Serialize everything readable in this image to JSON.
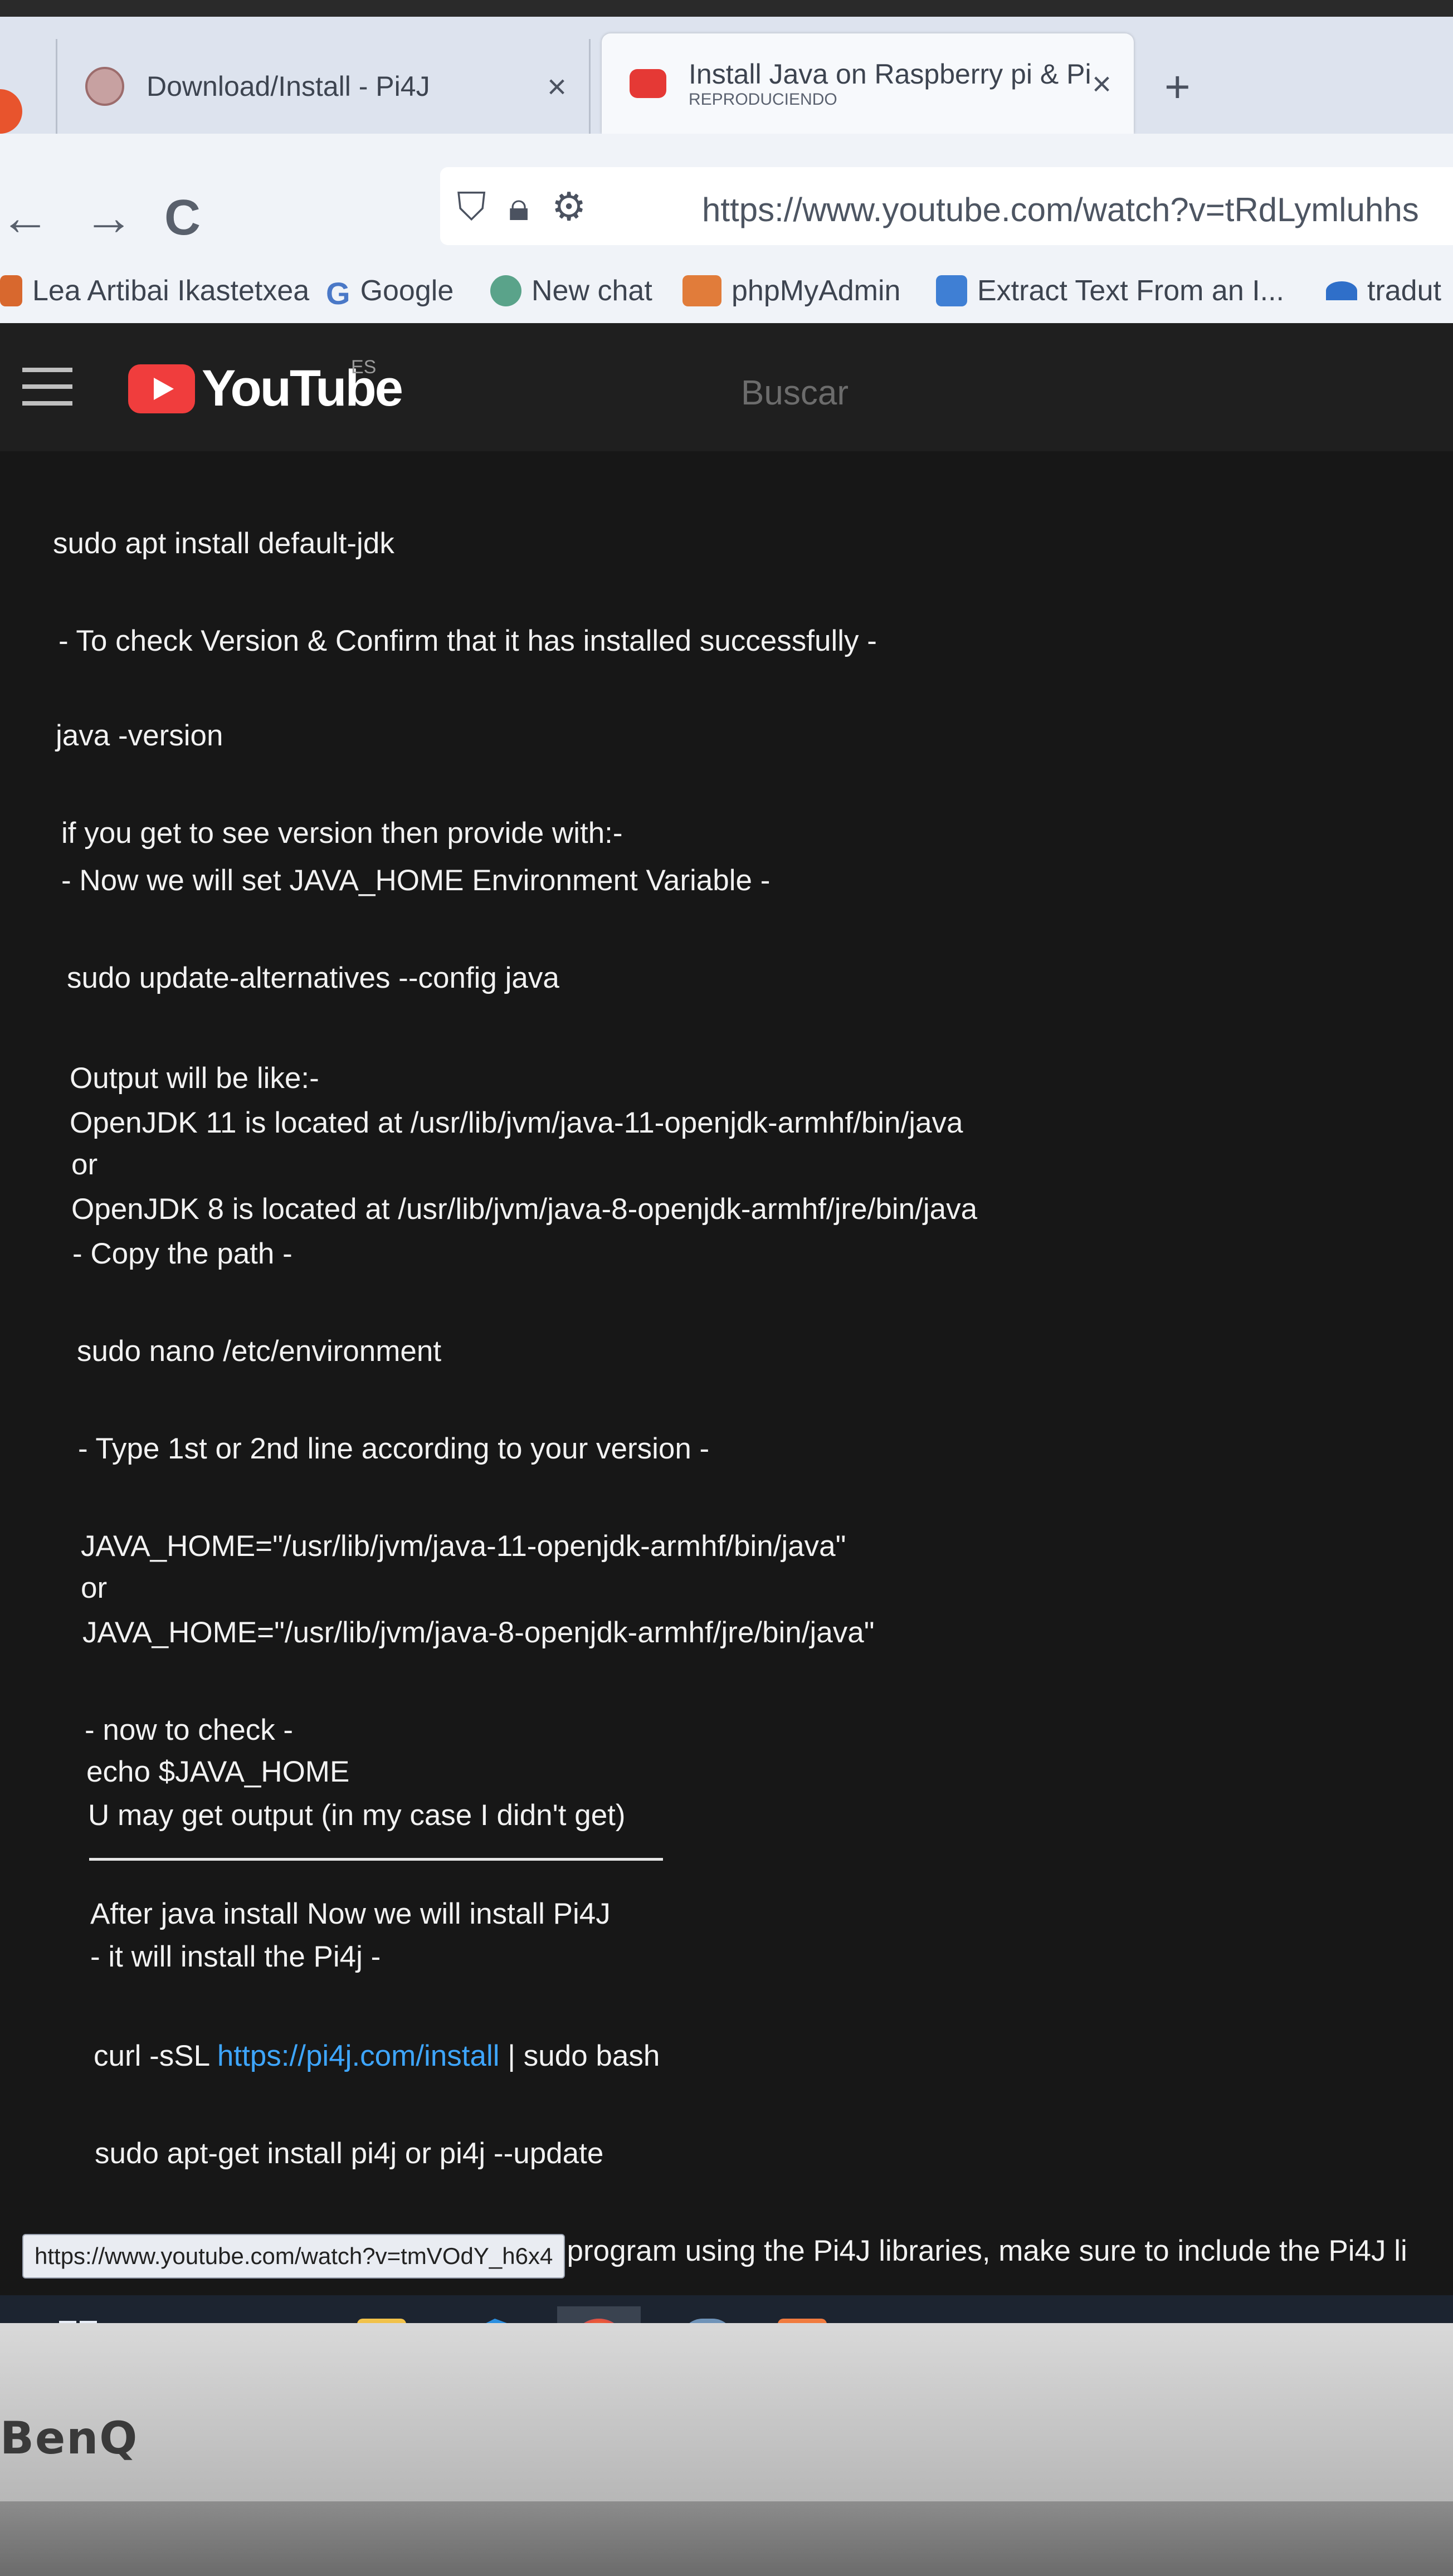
{
  "browser": {
    "tabs": [
      {
        "title": "Download/Install - Pi4J",
        "close": "×"
      },
      {
        "title": "Install Java on Raspberry pi & Pi",
        "subtitle": "REPRODUCIENDO",
        "close": "×"
      }
    ],
    "new_tab": "+",
    "nav": {
      "back": "←",
      "forward": "→",
      "reload": "C"
    },
    "url": "https://www.youtube.com/watch?v=tRdLymluhhs",
    "bookmarks": [
      {
        "label": "Lea Artibai Ikastetxea",
        "icon": "lea-artibai-icon"
      },
      {
        "label": "Google",
        "icon": "google-icon"
      },
      {
        "label": "New chat",
        "icon": "chatgpt-icon"
      },
      {
        "label": "phpMyAdmin",
        "icon": "phpmyadmin-icon"
      },
      {
        "label": "Extract Text From an I...",
        "icon": "extract-text-icon"
      },
      {
        "label": "tradut",
        "icon": "translator-icon"
      }
    ]
  },
  "youtube": {
    "logo_text": "YouTube",
    "region": "ES",
    "search_placeholder": "Buscar"
  },
  "description": {
    "lines": [
      "sudo apt install default-jdk",
      "- To check Version & Confirm that it has installed successfully -",
      "java -version",
      "if you get to see version then provide with:-",
      "- Now we will set JAVA_HOME Environment Variable -",
      "sudo update-alternatives --config java",
      "Output will be like:-",
      "OpenJDK 11 is located at /usr/lib/jvm/java-11-openjdk-armhf/bin/java",
      "or",
      "OpenJDK 8 is located at /usr/lib/jvm/java-8-openjdk-armhf/jre/bin/java",
      "- Copy the path -",
      "sudo nano /etc/environment",
      "- Type 1st or 2nd line according to your version -",
      "JAVA_HOME=\"/usr/lib/jvm/java-11-openjdk-armhf/bin/java\"",
      "or",
      "JAVA_HOME=\"/usr/lib/jvm/java-8-openjdk-armhf/jre/bin/java\"",
      "- now to check -",
      "echo $JAVA_HOME",
      "U may get output (in my case I didn't get)",
      "After java install Now we will install Pi4J",
      "- it will install the Pi4j -",
      "sudo apt-get install pi4j or pi4j --update",
      "When attempting to compile a Java program using the Pi4J libraries, make sure to include the Pi4J li"
    ],
    "curl_prefix": "curl -sSL ",
    "curl_link": "https://pi4j.com/install",
    "curl_suffix": " | sudo bash"
  },
  "status_bar_url": "https://www.youtube.com/watch?v=tmVOdY_h6x4",
  "taskbar": {
    "items": [
      "windows-start-icon",
      "search-icon",
      "task-view-icon",
      "file-explorer-icon",
      "vscode-icon",
      "firefox-icon",
      "postgresql-icon",
      "xampp-icon"
    ]
  },
  "monitor_brand": "BenQ",
  "colors": {
    "link": "#3ea6ff",
    "youtube_red": "#f03d3d",
    "page_bg": "#171717",
    "text": "#f2f2f2"
  }
}
